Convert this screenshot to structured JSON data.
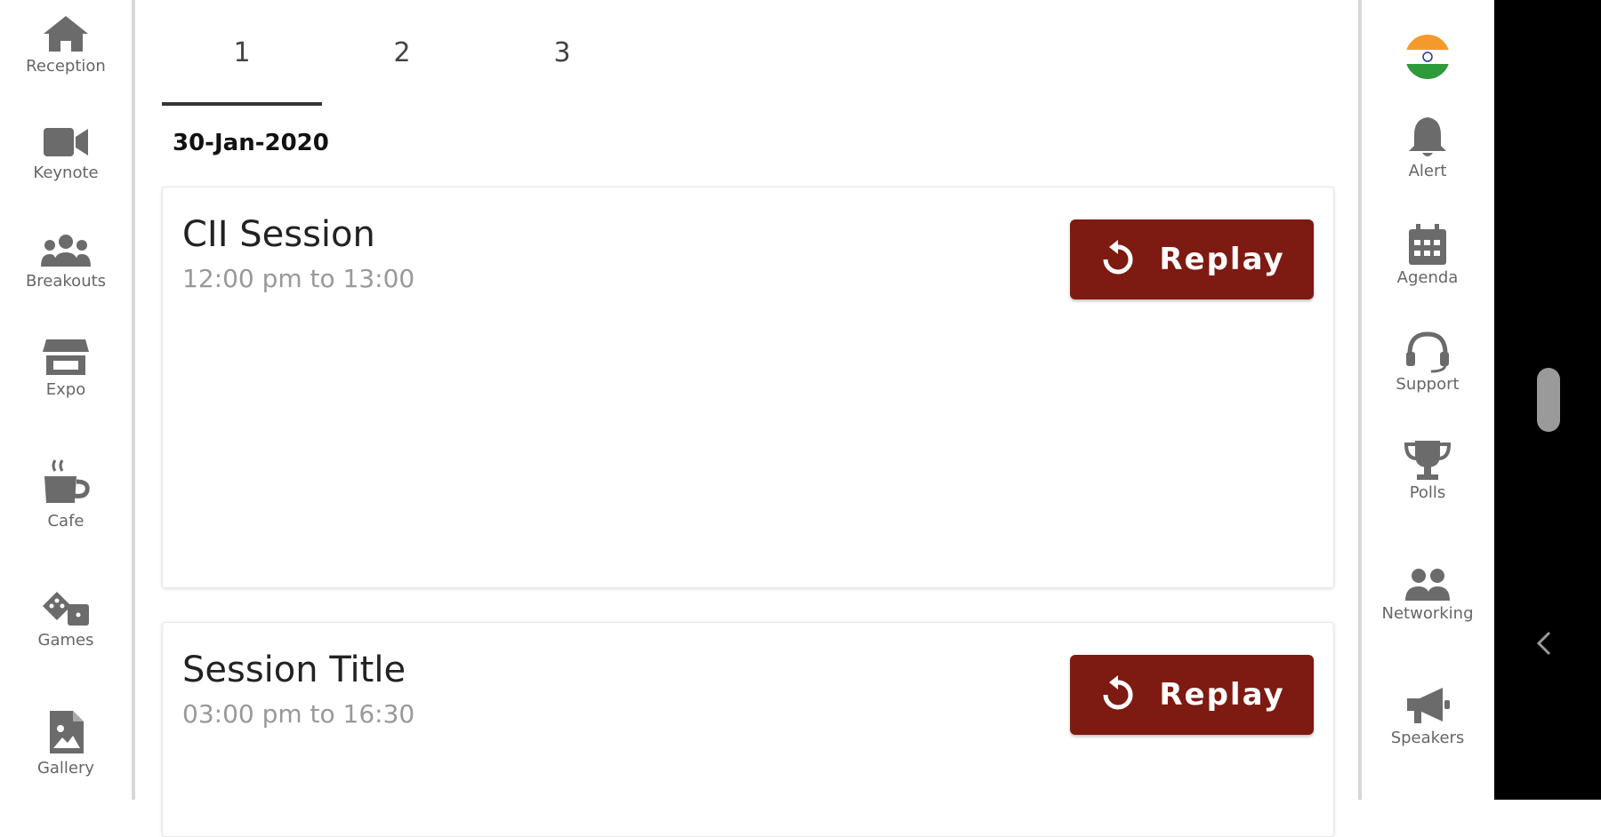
{
  "left_nav": [
    {
      "label": "Reception",
      "icon": "home-icon"
    },
    {
      "label": "Keynote",
      "icon": "video-camera-icon"
    },
    {
      "label": "Breakouts",
      "icon": "users-group-icon"
    },
    {
      "label": "Expo",
      "icon": "store-icon"
    },
    {
      "label": "Cafe",
      "icon": "coffee-cup-icon"
    },
    {
      "label": "Games",
      "icon": "dice-icon"
    },
    {
      "label": "Gallery",
      "icon": "image-file-icon"
    }
  ],
  "tabs": [
    {
      "label": "1",
      "active": true
    },
    {
      "label": "2",
      "active": false
    },
    {
      "label": "3",
      "active": false
    }
  ],
  "date": "30-Jan-2020",
  "sessions": [
    {
      "title": "CII Session",
      "time": "12:00 pm to 13:00",
      "button": "Replay"
    },
    {
      "title": "Session Title",
      "time": "03:00 pm to 16:30",
      "button": "Replay"
    }
  ],
  "right_nav": [
    {
      "label": "",
      "icon": "india-flag-icon"
    },
    {
      "label": "Alert",
      "icon": "bell-icon"
    },
    {
      "label": "Agenda",
      "icon": "calendar-icon"
    },
    {
      "label": "Support",
      "icon": "headset-icon"
    },
    {
      "label": "Polls",
      "icon": "trophy-icon"
    },
    {
      "label": "Networking",
      "icon": "people-icon"
    },
    {
      "label": "Speakers",
      "icon": "megaphone-icon"
    }
  ],
  "colors": {
    "accent": "#7d1a12",
    "icon_gray": "#6b6b6b"
  }
}
